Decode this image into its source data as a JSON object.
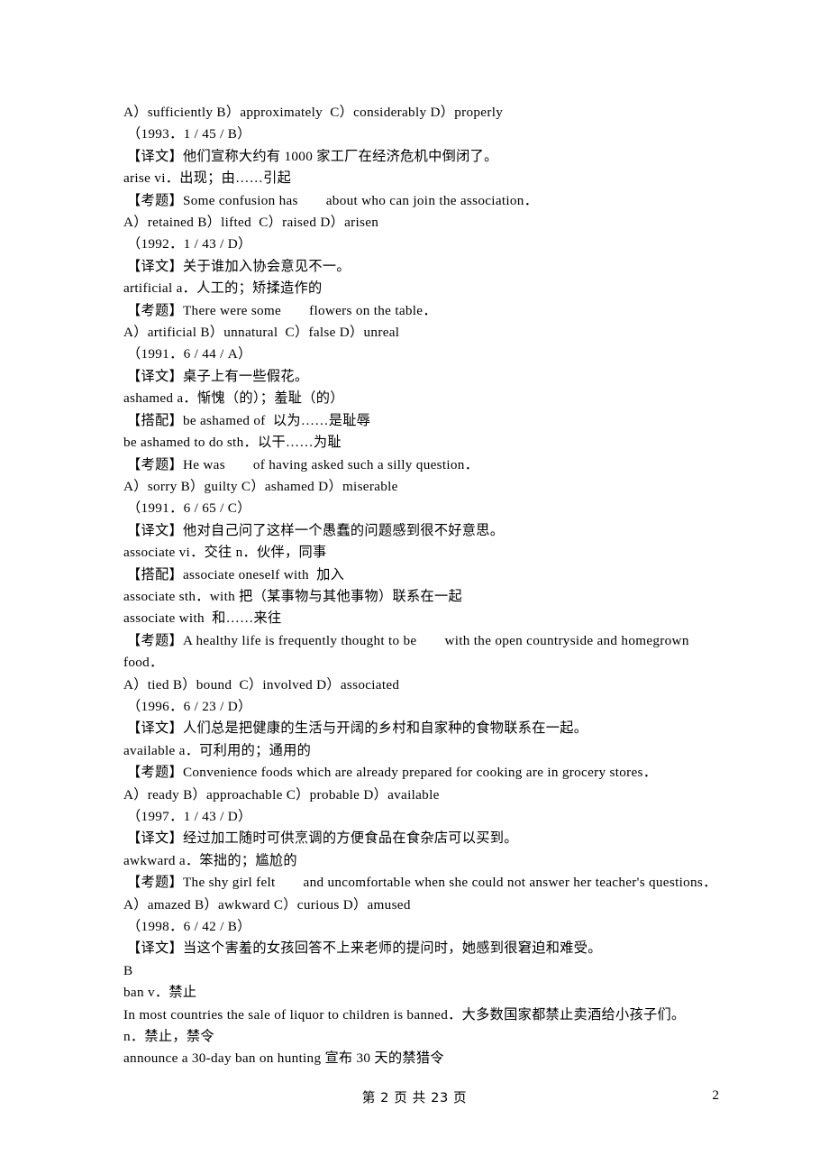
{
  "document": {
    "page_label": "2",
    "footer_center": "第 2 页 共 23 页",
    "footer_page_number": "2"
  },
  "lines": [
    {
      "id": "l01",
      "style": "flush",
      "text": "A）sufficiently B）approximately  C）considerably D）properly"
    },
    {
      "id": "l02",
      "style": "indent",
      "text": "（1993．1 / 45 / B）"
    },
    {
      "id": "l03",
      "style": "indent",
      "text": "【译文】他们宣称大约有 1000 家工厂在经济危机中倒闭了。"
    },
    {
      "id": "l04",
      "style": "flush",
      "text": "arise vi．出现；由……引起"
    },
    {
      "id": "l05",
      "style": "indent",
      "text": "【考题】Some confusion has　　about who can join the association．"
    },
    {
      "id": "l06",
      "style": "flush",
      "text": "A）retained B）lifted  C）raised D）arisen"
    },
    {
      "id": "l07",
      "style": "indent",
      "text": "（1992．1 / 43 / D）"
    },
    {
      "id": "l08",
      "style": "indent",
      "text": "【译文】关于谁加入协会意见不一。"
    },
    {
      "id": "l09",
      "style": "flush",
      "text": "artificial a．人工的；矫揉造作的"
    },
    {
      "id": "l10",
      "style": "indent",
      "text": "【考题】There were some　　flowers on the table．"
    },
    {
      "id": "l11",
      "style": "flush",
      "text": "A）artificial B）unnatural  C）false D）unreal"
    },
    {
      "id": "l12",
      "style": "indent",
      "text": "（1991．6 / 44 / A）"
    },
    {
      "id": "l13",
      "style": "indent",
      "text": "【译文】桌子上有一些假花。"
    },
    {
      "id": "l14",
      "style": "flush",
      "text": "ashamed a．惭愧（的）；羞耻（的）"
    },
    {
      "id": "l15",
      "style": "indent",
      "text": "【搭配】be ashamed of  以为……是耻辱"
    },
    {
      "id": "l16",
      "style": "flush",
      "text": "be ashamed to do sth．以干……为耻"
    },
    {
      "id": "l17",
      "style": "indent",
      "text": "【考题】He was　　of having asked such a silly question．"
    },
    {
      "id": "l18",
      "style": "flush",
      "text": "A）sorry B）guilty C）ashamed D）miserable"
    },
    {
      "id": "l19",
      "style": "indent",
      "text": "（1991．6 / 65 / C）"
    },
    {
      "id": "l20",
      "style": "indent",
      "text": "【译文】他对自己问了这样一个愚蠢的问题感到很不好意思。"
    },
    {
      "id": "l21",
      "style": "flush",
      "text": "associate vi．交往 n．伙伴，同事"
    },
    {
      "id": "l22",
      "style": "indent",
      "text": "【搭配】associate oneself with  加入"
    },
    {
      "id": "l23",
      "style": "flush",
      "text": "associate sth．with 把（某事物与其他事物）联系在一起"
    },
    {
      "id": "l24",
      "style": "flush",
      "text": "associate with  和……来往"
    },
    {
      "id": "l25",
      "style": "indent",
      "text": "【考题】A healthy life is frequently thought to be　　with the open countryside and homegrown"
    },
    {
      "id": "l26",
      "style": "wrap",
      "text": "food．"
    },
    {
      "id": "l27",
      "style": "flush",
      "text": "A）tied B）bound  C）involved D）associated"
    },
    {
      "id": "l28",
      "style": "indent",
      "text": "（1996．6 / 23 / D）"
    },
    {
      "id": "l29",
      "style": "indent",
      "text": "【译文】人们总是把健康的生活与开阔的乡村和自家种的食物联系在一起。"
    },
    {
      "id": "l30",
      "style": "flush",
      "text": "available a．可利用的；通用的"
    },
    {
      "id": "l31",
      "style": "indent",
      "text": "【考题】Convenience foods which are already prepared for cooking are in grocery stores．"
    },
    {
      "id": "l32",
      "style": "flush",
      "text": "A）ready B）approachable C）probable D）available"
    },
    {
      "id": "l33",
      "style": "indent",
      "text": "（1997．1 / 43 / D）"
    },
    {
      "id": "l34",
      "style": "indent",
      "text": "【译文】经过加工随时可供烹调的方便食品在食杂店可以买到。"
    },
    {
      "id": "l35",
      "style": "flush",
      "text": "awkward a．笨拙的；尴尬的"
    },
    {
      "id": "l36",
      "style": "indent",
      "text": "【考题】The shy girl felt　　and uncomfortable when she could not answer her teacher's questions．"
    },
    {
      "id": "l37",
      "style": "flush",
      "text": "A）amazed B）awkward C）curious D）amused"
    },
    {
      "id": "l38",
      "style": "indent",
      "text": "（1998．6 / 42 / B）"
    },
    {
      "id": "l39",
      "style": "indent",
      "text": "【译文】当这个害羞的女孩回答不上来老师的提问时，她感到很窘迫和难受。"
    },
    {
      "id": "l40",
      "style": "flush",
      "text": "B"
    },
    {
      "id": "l41",
      "style": "flush",
      "text": "ban v．禁止"
    },
    {
      "id": "l42",
      "style": "flush",
      "text": "In most countries the sale of liquor to children is banned．大多数国家都禁止卖酒给小孩子们。"
    },
    {
      "id": "l43",
      "style": "flush",
      "text": "n．禁止，禁令"
    },
    {
      "id": "l44",
      "style": "flush",
      "text": "announce a 30-day ban on hunting 宣布 30 天的禁猎令"
    }
  ]
}
